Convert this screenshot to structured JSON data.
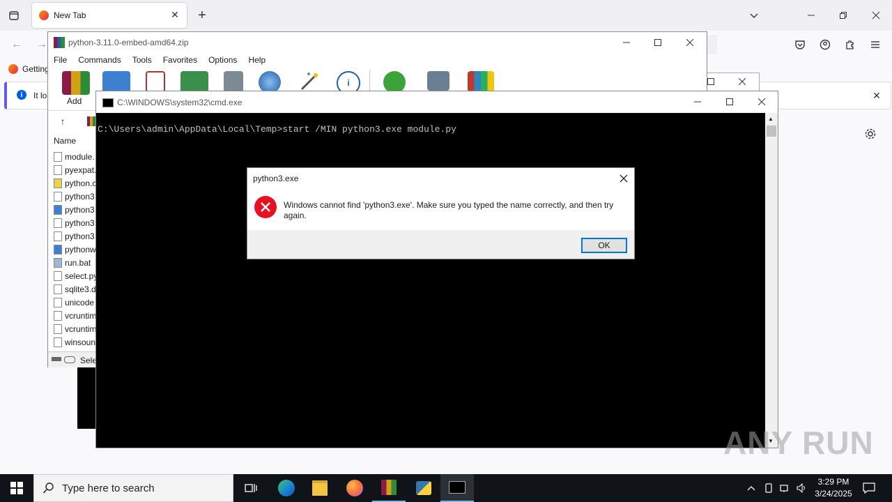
{
  "browser": {
    "tab_title": "New Tab",
    "bookmark_label": "Getting",
    "notice_text": "It loo"
  },
  "winrar": {
    "title": "python-3.11.0-embed-amd64.zip",
    "menu": [
      "File",
      "Commands",
      "Tools",
      "Favorites",
      "Options",
      "Help"
    ],
    "add_label": "Add",
    "column_name": "Name",
    "files": [
      "module.",
      "pyexpat.",
      "python.c",
      "python3",
      "python3",
      "python3",
      "python3",
      "pythonw",
      "run.bat",
      "select.py",
      "sqlite3.d",
      "unicode",
      "vcruntim",
      "vcruntim",
      "winsoun"
    ],
    "status_text": "Sele"
  },
  "cmd": {
    "title": "C:\\WINDOWS\\system32\\cmd.exe",
    "prompt_line": "C:\\Users\\admin\\AppData\\Local\\Temp>start /MIN python3.exe module.py"
  },
  "dialog": {
    "title": "python3.exe",
    "message": "Windows cannot find 'python3.exe'. Make sure you typed the name correctly, and then try again.",
    "ok_label": "OK"
  },
  "taskbar": {
    "search_placeholder": "Type here to search",
    "time": "3:29 PM",
    "date": "3/24/2025"
  },
  "watermark": "ANY RUN",
  "colors": {
    "error_red": "#e81123",
    "accent_blue": "#0078d7",
    "taskbar_bg": "#101318"
  }
}
